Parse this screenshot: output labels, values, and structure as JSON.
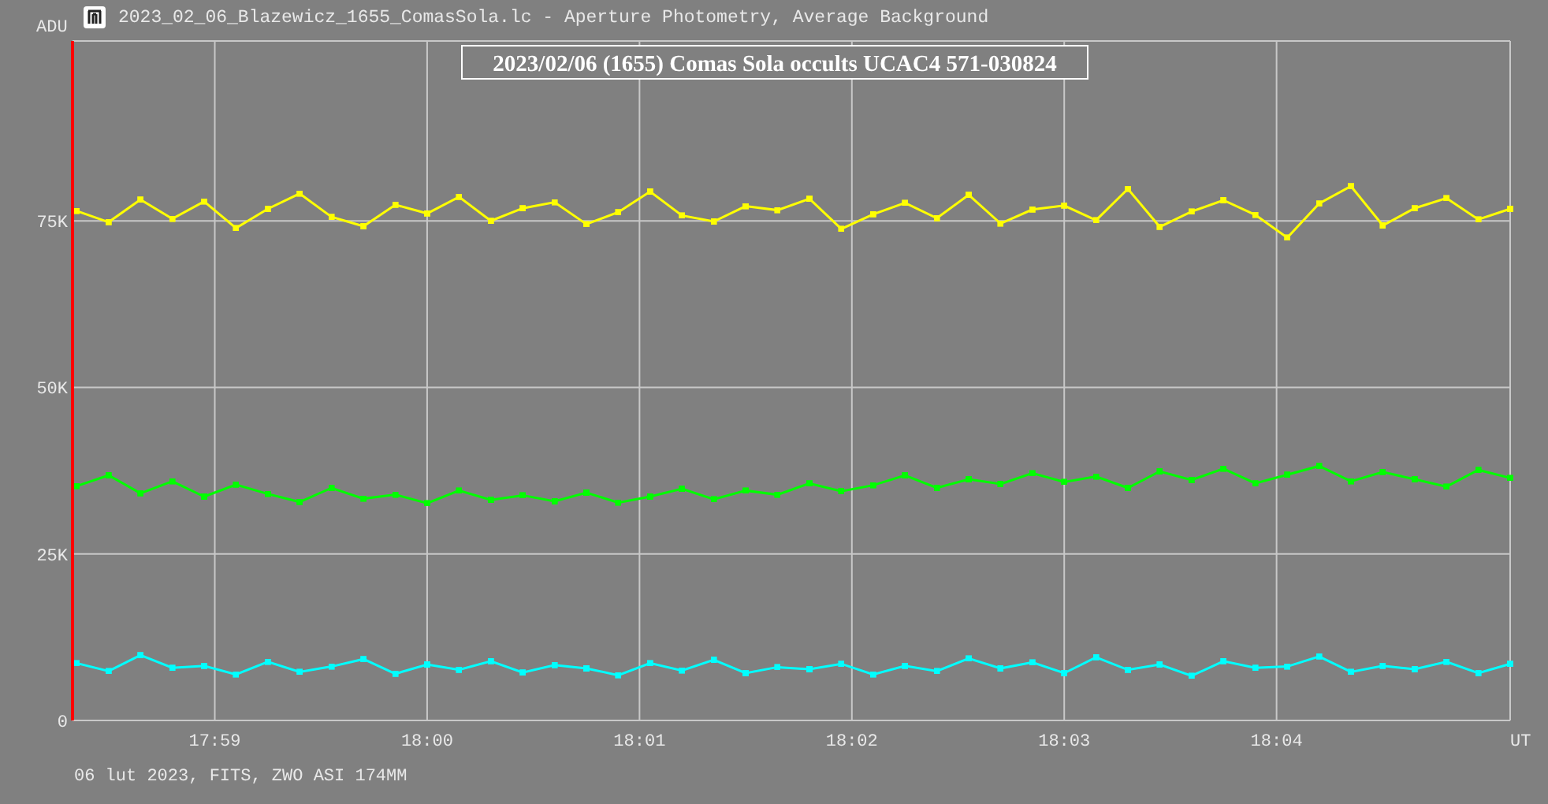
{
  "window": {
    "title": "2023_02_06_Blazewicz_1655_ComasSola.lc - Aperture Photometry, Average Background"
  },
  "plot": {
    "chart_data": {
      "type": "line",
      "title": "2023/02/06 (1655) Comas Sola occults UCAC4 571-030824",
      "xlabel": "UT",
      "ylabel": "ADU",
      "grid": true,
      "xlim": [
        1078.33,
        1085.1
      ],
      "ylim": [
        0,
        102000
      ],
      "xticks": [
        {
          "value": 1079,
          "label": "17:59"
        },
        {
          "value": 1080,
          "label": "18:00"
        },
        {
          "value": 1081,
          "label": "18:01"
        },
        {
          "value": 1082,
          "label": "18:02"
        },
        {
          "value": 1083,
          "label": "18:03"
        },
        {
          "value": 1084,
          "label": "18:04"
        }
      ],
      "yticks": [
        {
          "value": 0,
          "label": "0"
        },
        {
          "value": 25000,
          "label": "25K"
        },
        {
          "value": 50000,
          "label": "50K"
        },
        {
          "value": 75000,
          "label": "75K"
        }
      ],
      "x": [
        1078.35,
        1078.5,
        1078.65,
        1078.8,
        1078.95,
        1079.1,
        1079.25,
        1079.4,
        1079.55,
        1079.7,
        1079.85,
        1080.0,
        1080.15,
        1080.3,
        1080.45,
        1080.6,
        1080.75,
        1080.9,
        1081.05,
        1081.2,
        1081.35,
        1081.5,
        1081.65,
        1081.8,
        1081.95,
        1082.1,
        1082.25,
        1082.4,
        1082.55,
        1082.7,
        1082.85,
        1083.0,
        1083.15,
        1083.3,
        1083.45,
        1083.6,
        1083.75,
        1083.9,
        1084.05,
        1084.2,
        1084.35,
        1084.5,
        1084.65,
        1084.8,
        1084.95,
        1085.1
      ],
      "series": [
        {
          "color": "#ffff00",
          "values": [
            76500,
            74800,
            78200,
            75300,
            77900,
            73900,
            76800,
            79100,
            75600,
            74200,
            77400,
            76100,
            78600,
            75000,
            76900,
            77800,
            74500,
            76300,
            79400,
            75800,
            74900,
            77200,
            76600,
            78300,
            73800,
            76000,
            77700,
            75400,
            78900,
            74600,
            76700,
            77300,
            75100,
            79800,
            74100,
            76400,
            78100,
            75900,
            72500,
            77600,
            80200,
            74300,
            76900,
            78400,
            75200,
            76800
          ]
        },
        {
          "color": "#00ff00",
          "values": [
            35200,
            36800,
            34100,
            35900,
            33600,
            35400,
            34000,
            32800,
            34900,
            33300,
            33900,
            32600,
            34500,
            33100,
            33800,
            32900,
            34200,
            32700,
            33600,
            34800,
            33200,
            34500,
            33900,
            35600,
            34400,
            35300,
            36800,
            34900,
            36200,
            35500,
            37100,
            35800,
            36600,
            34900,
            37400,
            36100,
            37800,
            35600,
            36900,
            38200,
            35900,
            37300,
            36200,
            35100,
            37600,
            36400
          ]
        },
        {
          "color": "#00ffff",
          "values": [
            8600,
            7400,
            9800,
            7900,
            8200,
            6900,
            8800,
            7300,
            8100,
            9200,
            7000,
            8400,
            7600,
            8900,
            7200,
            8300,
            7800,
            6800,
            8600,
            7500,
            9100,
            7100,
            8000,
            7700,
            8500,
            6900,
            8200,
            7400,
            9300,
            7800,
            8700,
            7100,
            9500,
            7600,
            8400,
            6700,
            8900,
            7900,
            8100,
            9600,
            7300,
            8200,
            7700,
            8800,
            7100,
            8500
          ]
        }
      ]
    }
  },
  "footer": "06 lut 2023, FITS, ZWO ASI 174MM"
}
